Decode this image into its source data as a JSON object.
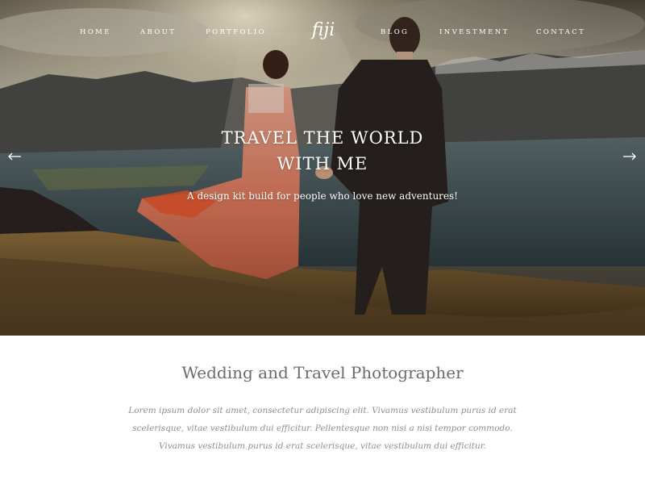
{
  "nav": {
    "items": [
      {
        "label": "HOME"
      },
      {
        "label": "ABOUT"
      },
      {
        "label": "PORTFOLIO"
      },
      {
        "label": "BLOG"
      },
      {
        "label": "INVESTMENT"
      },
      {
        "label": "CONTACT"
      }
    ],
    "logo": "fiji"
  },
  "hero": {
    "title_line1": "TRAVEL THE WORLD",
    "title_line2": "WITH ME",
    "subtitle": "A design kit build for people who love new adventures!",
    "prev_icon": "arrow-left-icon",
    "next_icon": "arrow-right-icon"
  },
  "intro": {
    "heading": "Wedding and Travel Photographer",
    "body": "Lorem ipsum dolor sit amet, consectetur adipiscing elit. Vivamus vestibulum purus id erat scelerisque, vitae vestibulum dui efficitur. Pellentesque non nisi a nisi tempor commodo. Vivamus vestibulum purus id erat scelerisque, vitae vestibulum dui efficitur."
  },
  "colors": {
    "nav_text": "#ffffff",
    "heading": "#6a6a6a",
    "body_text": "#8e8e8e",
    "dress": "#d9765a",
    "suit": "#2a2320"
  }
}
